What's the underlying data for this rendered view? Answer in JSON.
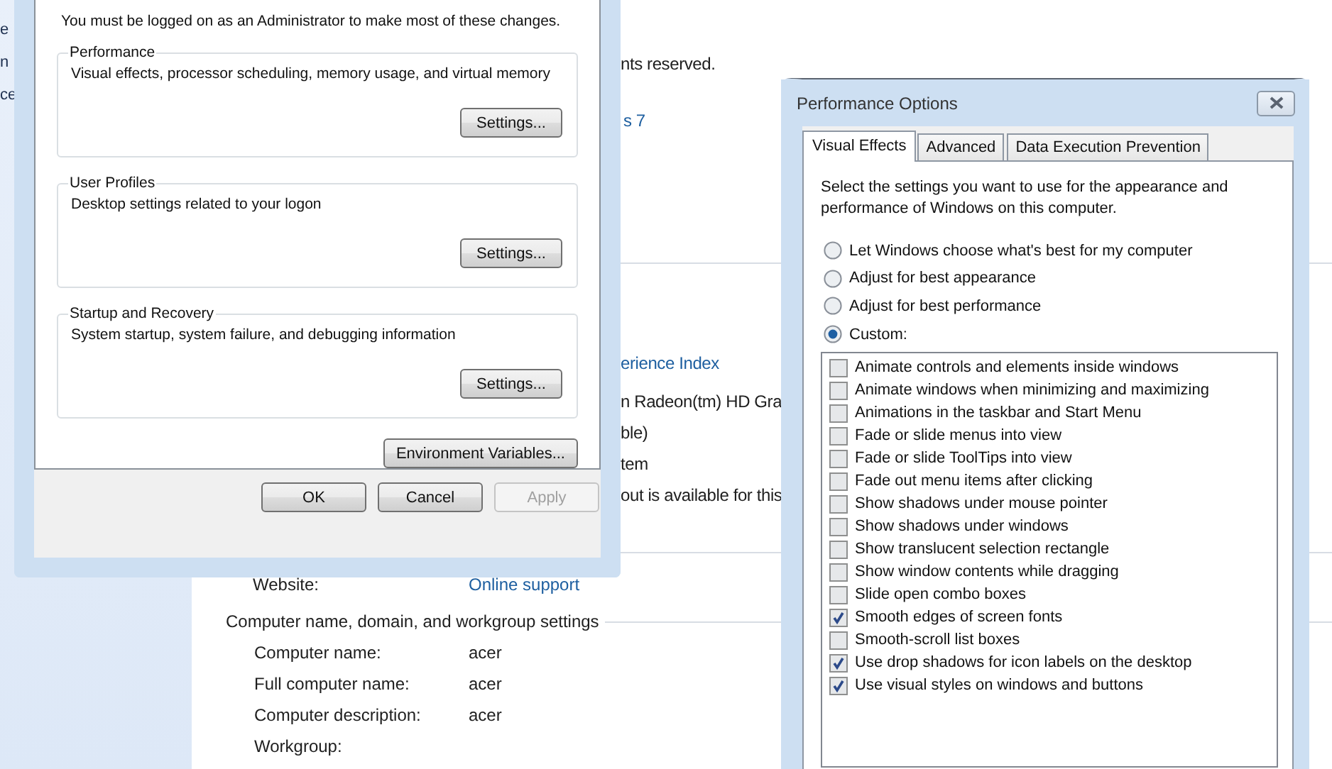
{
  "background_page": {
    "left_pane_fragments": [
      "e",
      "n",
      "ce"
    ],
    "fragments": [
      {
        "text": "nts reserved.",
        "kind": "text"
      },
      {
        "text": "s 7",
        "kind": "link"
      },
      {
        "text": "erience Index",
        "kind": "link"
      },
      {
        "text": "n Radeon(tm) HD Gra",
        "kind": "text"
      },
      {
        "text": "ble)",
        "kind": "text"
      },
      {
        "text": "tem",
        "kind": "text"
      },
      {
        "text": "out is available for this",
        "kind": "text"
      }
    ],
    "website": {
      "label": "Website:",
      "link": "Online support"
    },
    "section_title": "Computer name, domain, and workgroup settings",
    "rows": [
      {
        "label": "Computer name:",
        "value": "acer"
      },
      {
        "label": "Full computer name:",
        "value": "acer"
      },
      {
        "label": "Computer description:",
        "value": "acer"
      },
      {
        "label": "Workgroup:"
      }
    ]
  },
  "system_properties": {
    "notice": "You must be logged on as an Administrator to make most of these changes.",
    "groups": [
      {
        "title": "Performance",
        "description": "Visual effects, processor scheduling, memory usage, and virtual memory",
        "button": "Settings..."
      },
      {
        "title": "User Profiles",
        "description": "Desktop settings related to your logon",
        "button": "Settings..."
      },
      {
        "title": "Startup and Recovery",
        "description": "System startup, system failure, and debugging information",
        "button": "Settings..."
      }
    ],
    "extra_button": "Environment Variables...",
    "buttons": [
      {
        "label": "OK",
        "disabled": false
      },
      {
        "label": "Cancel",
        "disabled": false
      },
      {
        "label": "Apply",
        "disabled": true
      }
    ]
  },
  "performance_options": {
    "title": "Performance Options",
    "tabs": [
      {
        "label": "Visual Effects",
        "selected": true
      },
      {
        "label": "Advanced",
        "selected": false
      },
      {
        "label": "Data Execution Prevention",
        "selected": false
      }
    ],
    "intro": "Select the settings you want to use for the appearance and performance of Windows on this computer.",
    "options": [
      {
        "label": "Let Windows choose what's best for my computer",
        "selected": false
      },
      {
        "label": "Adjust for best appearance",
        "selected": false
      },
      {
        "label": "Adjust for best performance",
        "selected": false
      },
      {
        "label": "Custom:",
        "selected": true
      }
    ],
    "items": [
      {
        "label": "Animate controls and elements inside windows",
        "checked": false
      },
      {
        "label": "Animate windows when minimizing and maximizing",
        "checked": false
      },
      {
        "label": "Animations in the taskbar and Start Menu",
        "checked": false
      },
      {
        "label": "Fade or slide menus into view",
        "checked": false
      },
      {
        "label": "Fade or slide ToolTips into view",
        "checked": false
      },
      {
        "label": "Fade out menu items after clicking",
        "checked": false
      },
      {
        "label": "Show shadows under mouse pointer",
        "checked": false
      },
      {
        "label": "Show shadows under windows",
        "checked": false
      },
      {
        "label": "Show translucent selection rectangle",
        "checked": false
      },
      {
        "label": "Show window contents while dragging",
        "checked": false
      },
      {
        "label": "Slide open combo boxes",
        "checked": false
      },
      {
        "label": "Smooth edges of screen fonts",
        "checked": true
      },
      {
        "label": "Smooth-scroll list boxes",
        "checked": false
      },
      {
        "label": "Use drop shadows for icon labels on the desktop",
        "checked": true
      },
      {
        "label": "Use visual styles on windows and buttons",
        "checked": true
      }
    ]
  }
}
